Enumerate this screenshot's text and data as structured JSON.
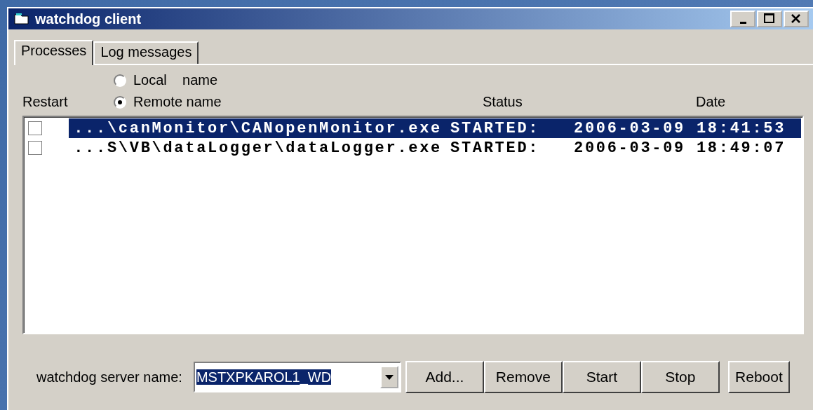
{
  "window": {
    "title": "watchdog client"
  },
  "tabs": [
    {
      "label": "Processes",
      "selected": true
    },
    {
      "label": "Log messages",
      "selected": false
    }
  ],
  "name_mode": [
    {
      "label": "Local    name",
      "selected": false
    },
    {
      "label": "Remote name",
      "selected": true
    }
  ],
  "table": {
    "columns": [
      "Restart",
      "Status",
      "Date"
    ],
    "rows": [
      {
        "restart": false,
        "path": "...\\canMonitor\\CANopenMonitor.exe",
        "status": "STARTED:",
        "date": "2006-03-09 18:41:53",
        "selected": true
      },
      {
        "restart": false,
        "path": "...S\\VB\\dataLogger\\dataLogger.exe",
        "status": "STARTED:",
        "date": "2006-03-09 18:49:07",
        "selected": false
      }
    ]
  },
  "server": {
    "label": "watchdog server name:",
    "value": "MSTXPKAROL1_WD"
  },
  "buttons": [
    "Add...",
    "Remove",
    "Start",
    "Stop",
    "Reboot"
  ]
}
